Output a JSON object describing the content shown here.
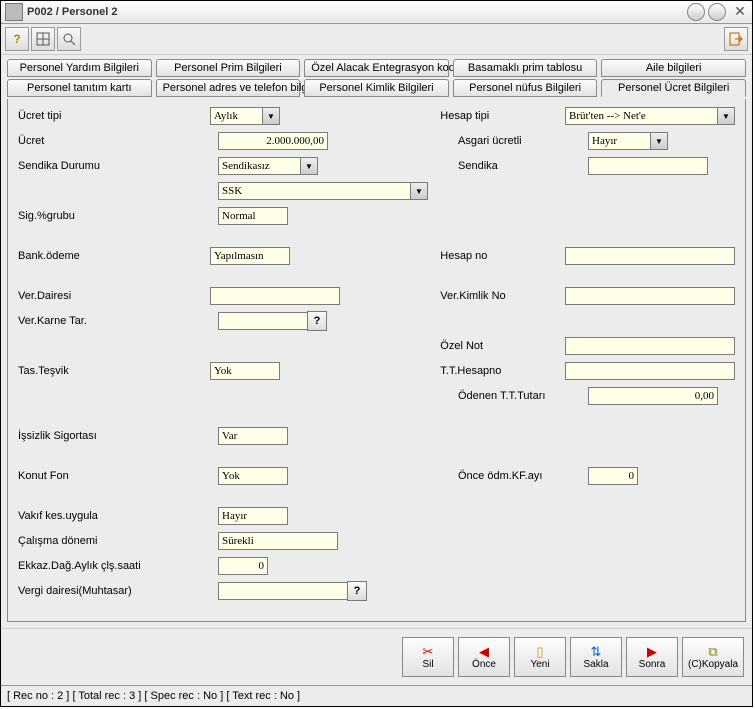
{
  "window": {
    "title": "P002 / Personel 2"
  },
  "toolbar": {
    "help": "?"
  },
  "tabsRow1": [
    "Personel Yardım Bilgileri",
    "Personel Prim Bilgileri",
    "Özel Alacak Entegrasyon kodları",
    "Basamaklı prim tablosu",
    "Aile bilgileri"
  ],
  "tabsRow2": [
    "Personel tanıtım kartı",
    "Personel adres ve telefon bilgileri",
    "Personel Kimlik Bilgileri",
    "Personel nüfus Bilgileri",
    "Personel Ücret Bilgileri"
  ],
  "labels": {
    "ucret_tipi": "Ücret tipi",
    "ucret": "Ücret",
    "sendika_durumu": "Sendika Durumu",
    "sig_grubu": "Sig.%grubu",
    "bank_odeme": "Bank.ödeme",
    "ver_dairesi": "Ver.Dairesi",
    "ver_karne_tar": "Ver.Karne Tar.",
    "tas_tesvik": "Tas.Teşvik",
    "issizlik": "İşsizlik Sigortası",
    "konut_fon": "Konut Fon",
    "vakif": "Vakıf kes.uygula",
    "calisma": "Çalışma dönemi",
    "ekkaz": "Ekkaz.Dağ.Aylık çlş.saati",
    "vergi_muhtasar": "Vergi dairesi(Muhtasar)",
    "hesap_tipi": "Hesap tipi",
    "asgari": "Asgari ücretli",
    "sendika": "Sendika",
    "hesap_no": "Hesap no",
    "ver_kimlik": "Ver.Kimlik No",
    "ozel_not": "Özel Not",
    "tt_hesapno": "T.T.Hesapno",
    "odenen_tt": "Ödenen T.T.Tutarı",
    "once_odm": "Önce ödm.KF.ayı"
  },
  "values": {
    "ucret_tipi": "Aylık",
    "ucret": "2.000.000,00",
    "sendika_durumu": "Sendikasız",
    "ssk": "SSK",
    "sig_grubu": "Normal",
    "bank_odeme": "Yapılmasın",
    "ver_dairesi": "",
    "ver_karne_tar": "",
    "tas_tesvik": "Yok",
    "issizlik": "Var",
    "konut_fon": "Yok",
    "vakif": "Hayır",
    "calisma": "Sürekli",
    "ekkaz": "0",
    "vergi_muhtasar": "",
    "hesap_tipi": "Brüt'ten --> Net'e",
    "asgari": "Hayır",
    "sendika_val": "",
    "hesap_no": "",
    "ver_kimlik": "",
    "ozel_not": "",
    "tt_hesapno": "",
    "odenen_tt": "0,00",
    "once_odm": "0"
  },
  "actions": {
    "sil": "Sil",
    "once": "Önce",
    "yeni": "Yeni",
    "sakla": "Sakla",
    "sonra": "Sonra",
    "kopyala": "(C)Kopyala"
  },
  "status": {
    "rec": "[ Rec no : 2 ]",
    "total": "[ Total rec  : 3 ]",
    "spec": "[ Spec rec : No ]",
    "text": "[ Text rec : No ]"
  }
}
